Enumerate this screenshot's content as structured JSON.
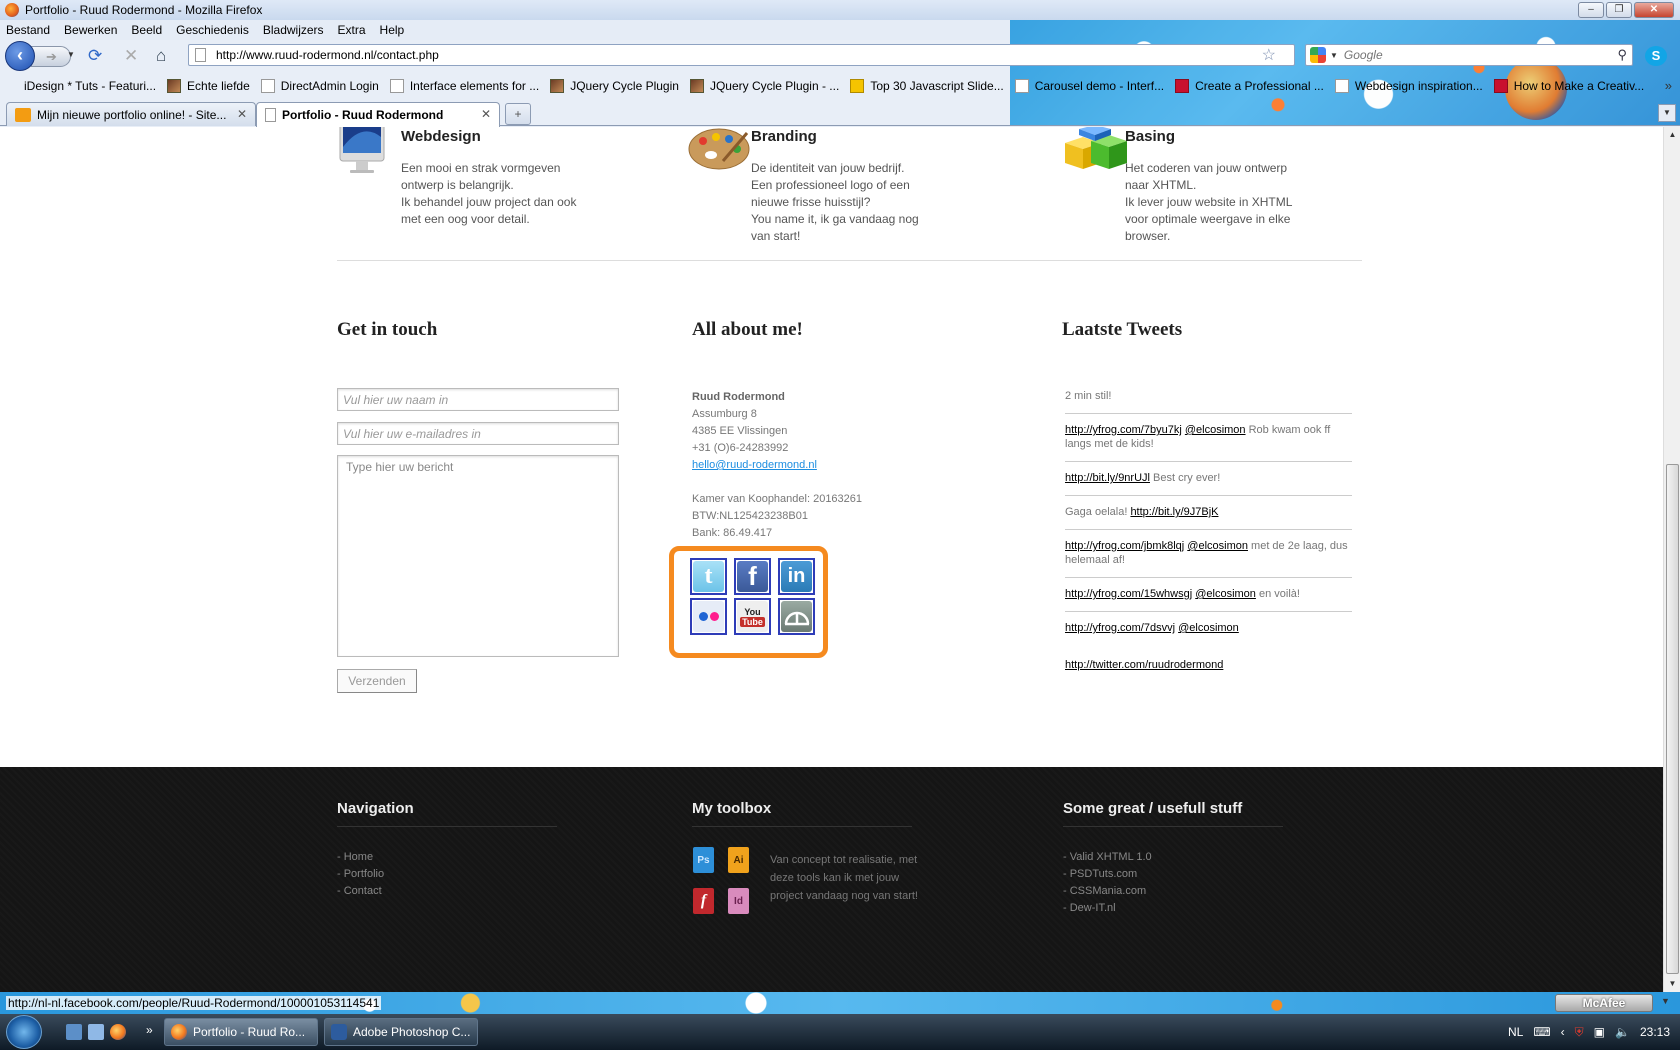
{
  "window": {
    "title": "Portfolio - Ruud Rodermond - Mozilla Firefox"
  },
  "menu": [
    "Bestand",
    "Bewerken",
    "Beeld",
    "Geschiedenis",
    "Bladwijzers",
    "Extra",
    "Help"
  ],
  "navigation": {
    "url": "http://www.ruud-rodermond.nl/contact.php",
    "search_placeholder": "Google"
  },
  "bookmarks": [
    {
      "label": "iDesign * Tuts - Featuri...",
      "icon": "page"
    },
    {
      "label": "Echte liefde",
      "icon": "image"
    },
    {
      "label": "DirectAdmin Login",
      "icon": "page"
    },
    {
      "label": "Interface elements for ...",
      "icon": "page"
    },
    {
      "label": "JQuery Cycle Plugin",
      "icon": "image"
    },
    {
      "label": "JQuery Cycle Plugin - ...",
      "icon": "image"
    },
    {
      "label": "Top 30 Javascript Slide...",
      "icon": "v"
    },
    {
      "label": "Carousel demo - Interf...",
      "icon": "page"
    },
    {
      "label": "Create a Professional ...",
      "icon": "red"
    },
    {
      "label": "Webdesign inspiration...",
      "icon": "page"
    },
    {
      "label": "How to Make a Creativ...",
      "icon": "red"
    }
  ],
  "tabs": [
    {
      "label": "Mijn nieuwe portfolio online! - Site...",
      "active": false
    },
    {
      "label": "Portfolio - Ruud Rodermond",
      "active": true
    }
  ],
  "services": [
    {
      "title": "Webdesign",
      "icon": "imac-icon",
      "lines": [
        "Een mooi en strak vormgeven",
        "ontwerp is belangrijk.",
        "Ik behandel jouw project dan ook",
        "met een oog voor detail."
      ]
    },
    {
      "title": "Branding",
      "icon": "palette-icon",
      "lines": [
        "De identiteit van jouw bedrijf.",
        "Een professioneel logo of een",
        "nieuwe frisse huisstijl?",
        "You name it, ik ga vandaag nog",
        "van start!"
      ]
    },
    {
      "title": "Basing",
      "icon": "cubes-icon",
      "lines": [
        "Het coderen van jouw ontwerp",
        "naar XHTML.",
        "Ik lever jouw website in XHTML",
        "voor optimale weergave in elke",
        "browser."
      ]
    }
  ],
  "contact": {
    "title": "Get in touch",
    "name_placeholder": "Vul hier uw naam in",
    "email_placeholder": "Vul hier uw e-mailadres in",
    "message_placeholder": "Type hier uw bericht",
    "submit_label": "Verzenden"
  },
  "about": {
    "title": "All about me!",
    "name": "Ruud Rodermond",
    "street": "Assumburg 8",
    "city": "4385 EE Vlissingen",
    "phone": "+31 (O)6-24283992",
    "email": "hello@ruud-rodermond.nl",
    "kvk": "Kamer van Koophandel: 20163261",
    "btw": "BTW:NL125423238B01",
    "bank": "Bank: 86.49.417",
    "social": [
      {
        "name": "twitter",
        "glyph": "t",
        "color": "#6cc3e8"
      },
      {
        "name": "facebook",
        "glyph": "f",
        "color": "#3b5998"
      },
      {
        "name": "linkedin",
        "glyph": "in",
        "color": "#2a7bb6"
      },
      {
        "name": "flickr",
        "glyph": "",
        "color": "#e6ecf7"
      },
      {
        "name": "youtube",
        "glyph": "You Tube",
        "color": "#c4302b"
      },
      {
        "name": "deviantart",
        "glyph": "",
        "color": "#7b8a83"
      }
    ],
    "highlight_color": "#f58a1f"
  },
  "tweets": {
    "title": "Laatste Tweets",
    "first": "2 min stil!",
    "items": [
      {
        "link": "http://yfrog.com/7byu7kj",
        "user": "@elcosimon",
        "text": " Rob kwam ook ff langs met de kids!",
        "link_first": true
      },
      {
        "link": "http://bit.ly/9nrUJl",
        "user": "",
        "text": " Best cry ever!",
        "link_first": true
      },
      {
        "link": "http://bit.ly/9J7BjK",
        "user": "",
        "text": "Gaga oelala! ",
        "link_first": false
      },
      {
        "link": "http://yfrog.com/jbmk8lqj",
        "user": "@elcosimon",
        "text": " met de 2e laag, dus helemaal af!",
        "link_first": true
      },
      {
        "link": "http://yfrog.com/15whwsgj",
        "user": "@elcosimon",
        "text": " en voilà!",
        "link_first": true
      },
      {
        "link": "http://yfrog.com/7dsvvj",
        "user": "@elcosimon",
        "text": "",
        "link_first": true
      }
    ],
    "profile": "http://twitter.com/ruudrodermond"
  },
  "footer": {
    "navigation_title": "Navigation",
    "navigation_links": [
      "- Home",
      "- Portfolio",
      "- Contact"
    ],
    "toolbox_title": "My toolbox",
    "tools": [
      {
        "name": "photoshop",
        "glyph": "Ps",
        "color": "#2d8fd8"
      },
      {
        "name": "illustrator",
        "glyph": "Ai",
        "color": "#f0a21c"
      },
      {
        "name": "flash",
        "glyph": "f",
        "color": "#c1282d"
      },
      {
        "name": "indesign",
        "glyph": "Id",
        "color": "#d98bbd"
      }
    ],
    "toolbox_text": "Van concept tot realisatie, met deze tools kan ik met jouw project vandaag nog van start!",
    "stuff_title": "Some great / usefull stuff",
    "stuff_links": [
      "- Valid XHTML 1.0",
      "- PSDTuts.com",
      "- CSSMania.com",
      "- Dew-IT.nl"
    ]
  },
  "status": {
    "text": "http://nl-nl.facebook.com/people/Ruud-Rodermond/100001053114541",
    "mcafee": "McAfee"
  },
  "taskbar": {
    "tasks": [
      "Portfolio - Ruud Ro...",
      "Adobe Photoshop C..."
    ],
    "lang": "NL",
    "clock": "23:13"
  }
}
